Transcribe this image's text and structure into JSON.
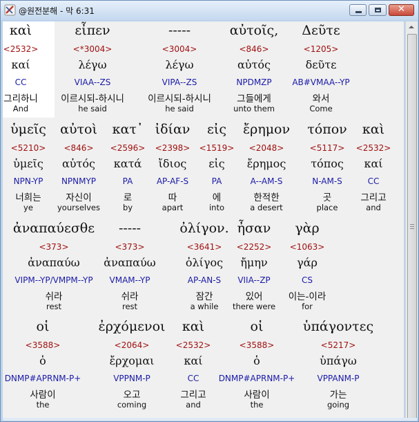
{
  "window": {
    "title": "@원전분해 - 막 6:31",
    "close_glyph": "✕"
  },
  "lines": [
    {
      "tokens": [
        {
          "greek": "καὶ",
          "strongs": "<2532>",
          "lexeme": "καί",
          "morph": "CC",
          "korean": "그리하니",
          "english": "And"
        },
        {
          "greek": "εἶπεν",
          "strongs": "<*3004>",
          "lexeme": "λέγω",
          "morph": "VIAA--ZS",
          "korean": "이르시되-하시니",
          "english": "he said"
        },
        {
          "greek": "-----",
          "strongs": "<3004>",
          "lexeme": "λέγω",
          "morph": "VIPA--ZS",
          "korean": "이르시되-하시니",
          "english": "he said"
        },
        {
          "greek": "αὐτοῖς,",
          "strongs": "<846>",
          "lexeme": "αὐτός",
          "morph": "NPDMZP",
          "korean": "그들에게",
          "english": "unto them"
        },
        {
          "greek": "Δεῦτε",
          "strongs": "<1205>",
          "lexeme": "δεῦτε",
          "morph": "AB#VMAA--YP",
          "korean": "와서",
          "english": "Come"
        }
      ]
    },
    {
      "tokens": [
        {
          "greek": "ὑμεῖς",
          "strongs": "<5210>",
          "lexeme": "ὑμεῖς",
          "morph": "NPN-YP",
          "korean": "너희는",
          "english": "ye"
        },
        {
          "greek": "αὐτοὶ",
          "strongs": "<846>",
          "lexeme": "αὐτός",
          "morph": "NPNMYP",
          "korean": "자신이",
          "english": "yourselves"
        },
        {
          "greek": "κατ᾽",
          "strongs": "<2596>",
          "lexeme": "κατά",
          "morph": "PA",
          "korean": "로",
          "english": "by"
        },
        {
          "greek": "ἰδίαν",
          "strongs": "<2398>",
          "lexeme": "ἴδιος",
          "morph": "AP-AF-S",
          "korean": "따",
          "english": "apart"
        },
        {
          "greek": "εἰς",
          "strongs": "<1519>",
          "lexeme": "εἰς",
          "morph": "PA",
          "korean": "에",
          "english": "into"
        },
        {
          "greek": "ἔρημον",
          "strongs": "<2048>",
          "lexeme": "ἔρημος",
          "morph": "A--AM-S",
          "korean": "한적한",
          "english": "a desert"
        },
        {
          "greek": "τόπον",
          "strongs": "<5117>",
          "lexeme": "τόπος",
          "morph": "N-AM-S",
          "korean": "곳",
          "english": "place"
        },
        {
          "greek": "καὶ",
          "strongs": "<2532>",
          "lexeme": "καί",
          "morph": "CC",
          "korean": "그리고",
          "english": "and"
        }
      ]
    },
    {
      "tokens": [
        {
          "greek": "ἀναπαύεσθε",
          "strongs": "<373>",
          "lexeme": "ἀναπαύω",
          "morph": "VIPM--YP/VMPM--YP",
          "korean": "쉬라",
          "english": "rest"
        },
        {
          "greek": "-----",
          "strongs": "<373>",
          "lexeme": "ἀναπαύω",
          "morph": "VMAM--YP",
          "korean": "쉬라",
          "english": "rest"
        },
        {
          "greek": "ὀλίγον.",
          "strongs": "<3641>",
          "lexeme": "ὀλίγος",
          "morph": "AP-AN-S",
          "korean": "잠간",
          "english": "a while"
        },
        {
          "greek": "ἦσαν",
          "strongs": "<2252>",
          "lexeme": "ἤμην",
          "morph": "VIIA--ZP",
          "korean": "있어",
          "english": "there were"
        },
        {
          "greek": "γὰρ",
          "strongs": "<1063>",
          "lexeme": "γάρ",
          "morph": "CS",
          "korean": "이는-이라",
          "english": "for"
        }
      ]
    },
    {
      "tokens": [
        {
          "greek": "οἱ",
          "strongs": "<3588>",
          "lexeme": "ὁ",
          "morph": "DNMP#APRNM-P+",
          "korean": "사람이",
          "english": "the"
        },
        {
          "greek": "ἐρχόμενοι",
          "strongs": "<2064>",
          "lexeme": "ἔρχομαι",
          "morph": "VPPNM-P",
          "korean": "오고",
          "english": "coming"
        },
        {
          "greek": "καὶ",
          "strongs": "<2532>",
          "lexeme": "καί",
          "morph": "CC",
          "korean": "그리고",
          "english": "and"
        },
        {
          "greek": "οἱ",
          "strongs": "<3588>",
          "lexeme": "ὁ",
          "morph": "DNMP#APRNM-P+",
          "korean": "사람이",
          "english": "the"
        },
        {
          "greek": "ὑπάγοντες",
          "strongs": "<5217>",
          "lexeme": "ὑπάγω",
          "morph": "VPPANM-P",
          "korean": "가는",
          "english": "going"
        }
      ]
    }
  ]
}
